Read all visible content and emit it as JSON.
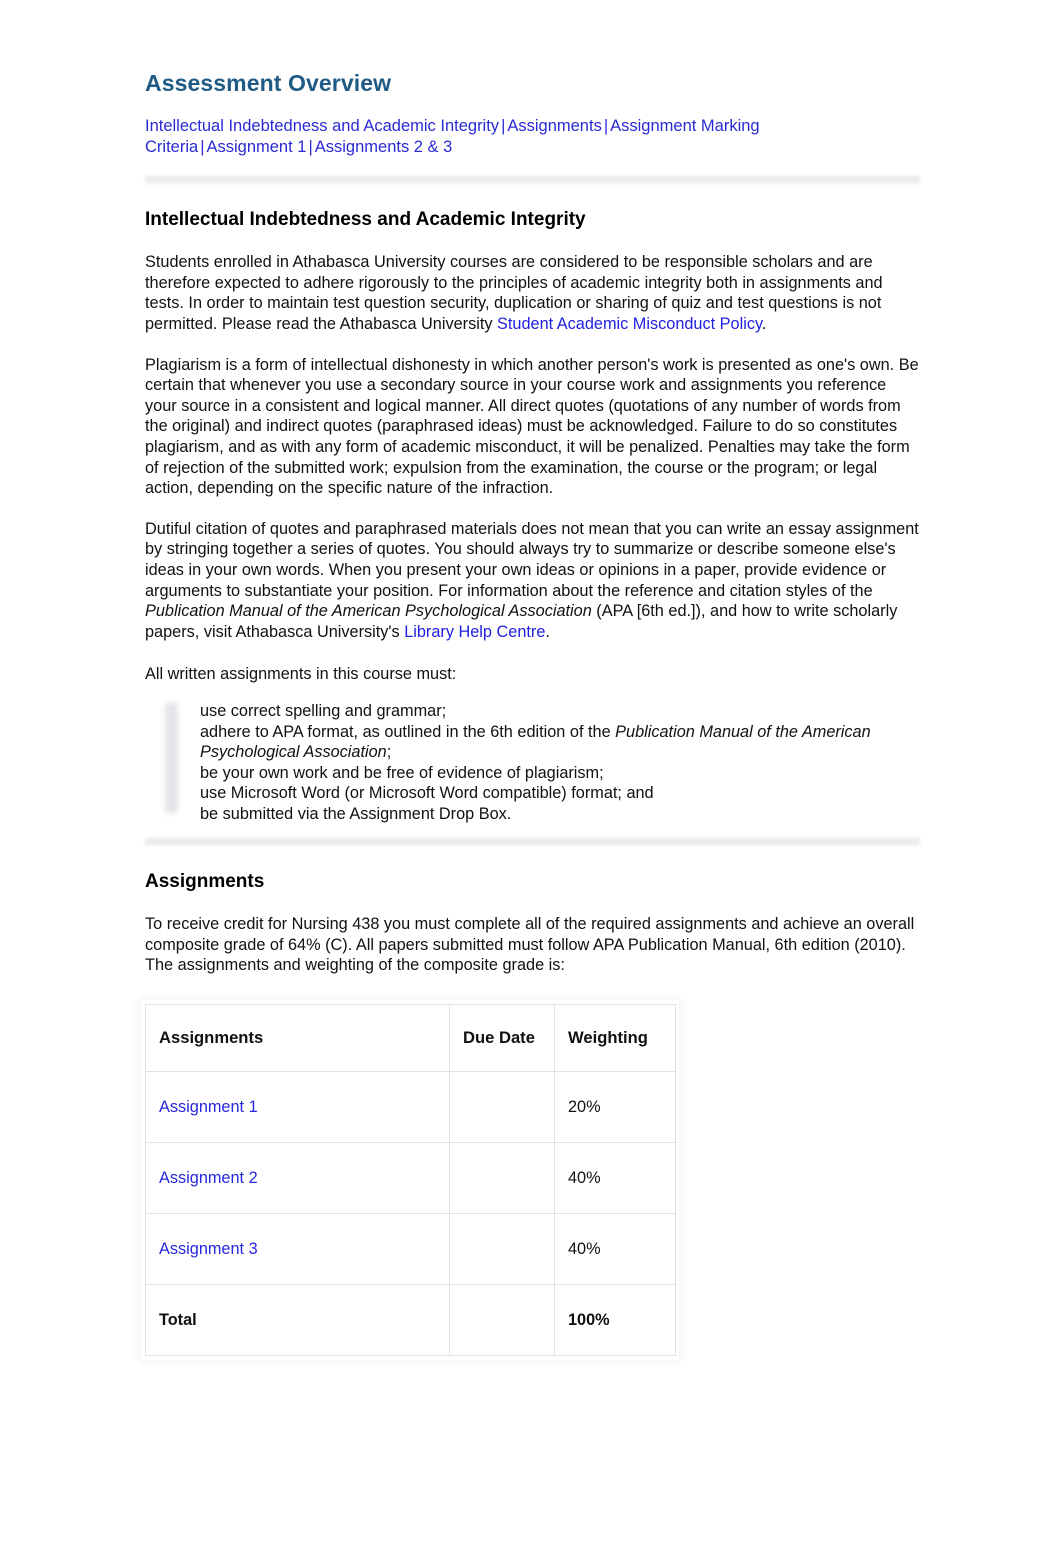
{
  "document": {
    "title": "Assessment Overview",
    "title_color": "#1f5b84",
    "link_color": "#2222cc",
    "inline_link_color": "#2020e0"
  },
  "nav": {
    "items": [
      "Intellectual Indebtedness and Academic Integrity",
      "Assignments",
      "Assignment Marking Criteria",
      "Assignment 1",
      "Assignments 2 & 3"
    ],
    "separator": "|"
  },
  "sections": {
    "integrity": {
      "heading": "Intellectual Indebtedness and Academic Integrity",
      "p1_before_link": "Students enrolled in Athabasca University courses are considered to be responsible scholars and are therefore expected to adhere rigorously to the principles of academic integrity both in assignments and tests. In order to maintain test question security, duplication or sharing of quiz and test questions is not permitted. Please read the Athabasca University ",
      "p1_link": "Student Academic Misconduct Policy",
      "p1_after_link": ".",
      "p2": "Plagiarism is a form of intellectual dishonesty in which another person's work is presented as one's own. Be certain that whenever you use a secondary source in your course work and assignments you reference your source in a consistent and logical manner. All direct quotes (quotations of any number of words from the original) and indirect quotes (paraphrased ideas) must be acknowledged. Failure to do so constitutes plagiarism, and as with any form of academic misconduct, it will be penalized. Penalties may take the form of rejection of the submitted work; expulsion from the examination, the course or the program; or legal action, depending on the specific nature of the infraction.",
      "p3_part1": "Dutiful citation of quotes and paraphrased materials does not mean that you can write an essay assignment by stringing together a series of quotes. You should always try to summarize or describe someone else's ideas in your own words. When you present your own ideas or opinions in a paper, provide evidence or arguments to substantiate your position. For information about the reference and citation styles of the ",
      "p3_italic": "Publication Manual of the American Psychological Association",
      "p3_part2": " (APA [6th ed.]), and how to write scholarly papers, visit Athabasca University's ",
      "p3_link": "Library Help Centre",
      "p3_part3": ".",
      "list_intro": "All written assignments in this course must:",
      "list_items": [
        {
          "text_before": "use correct spelling and grammar;",
          "italic": "",
          "text_after": ""
        },
        {
          "text_before": "adhere to APA format, as outlined in the 6th edition of the ",
          "italic": "Publication Manual of the American Psychological Association",
          "text_after": ";"
        },
        {
          "text_before": "be your own work and be free of evidence of plagiarism;",
          "italic": "",
          "text_after": ""
        },
        {
          "text_before": "use Microsoft Word (or Microsoft Word compatible) format; and",
          "italic": "",
          "text_after": ""
        },
        {
          "text_before": "be submitted via the Assignment Drop Box.",
          "italic": "",
          "text_after": ""
        }
      ]
    },
    "assignments": {
      "heading": "Assignments",
      "intro": "To receive credit for Nursing 438 you must complete all of the required assignments and achieve an overall composite grade of 64% (C). All papers submitted must follow APA Publication Manual, 6th edition (2010). The assignments and weighting of the composite grade is:",
      "table": {
        "headers": [
          "Assignments",
          "Due Date",
          "Weighting"
        ],
        "rows": [
          {
            "assignment": "Assignment 1",
            "is_link": true,
            "due_date": "",
            "weighting": "20%",
            "is_total": false
          },
          {
            "assignment": "Assignment 2",
            "is_link": true,
            "due_date": "",
            "weighting": "40%",
            "is_total": false
          },
          {
            "assignment": "Assignment 3",
            "is_link": true,
            "due_date": "",
            "weighting": "40%",
            "is_total": false
          },
          {
            "assignment": "Total",
            "is_link": false,
            "due_date": "",
            "weighting": "100%",
            "is_total": true
          }
        ]
      }
    }
  }
}
